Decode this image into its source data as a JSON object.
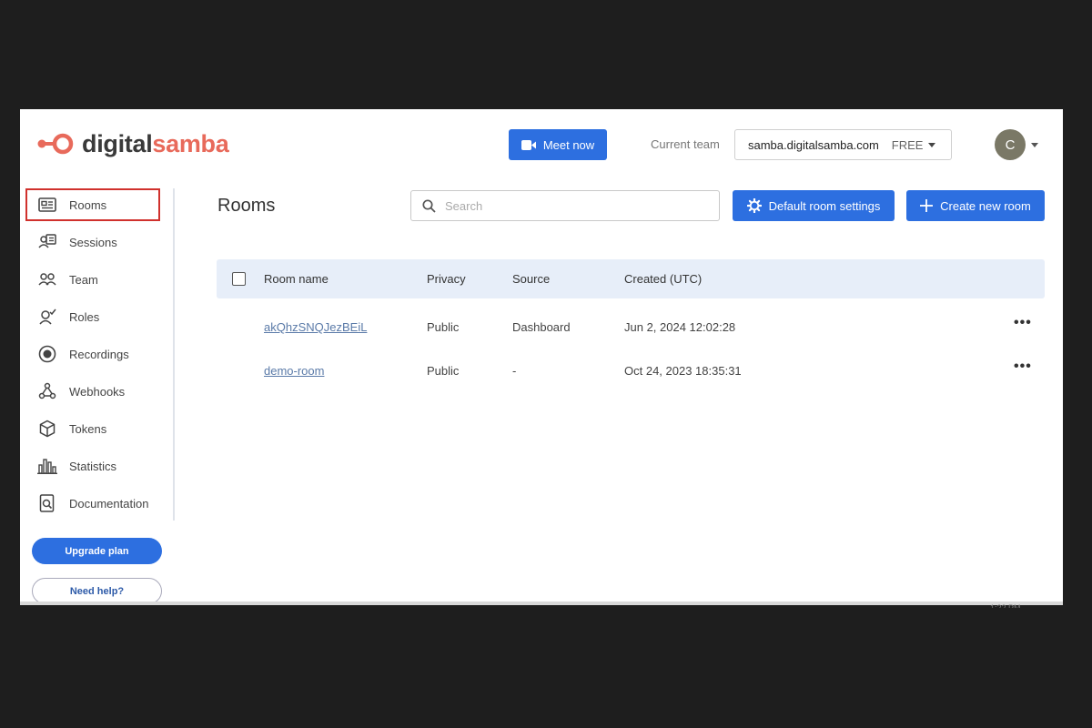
{
  "header": {
    "logo_dark": "digital",
    "logo_accent": "samba",
    "meet_now": "Meet now",
    "current_team_label": "Current team",
    "team_name": "samba.digitalsamba.com",
    "team_plan": "FREE",
    "avatar_initial": "C"
  },
  "sidebar": {
    "items": [
      {
        "label": "Rooms",
        "icon": "rooms-icon"
      },
      {
        "label": "Sessions",
        "icon": "sessions-icon"
      },
      {
        "label": "Team",
        "icon": "team-icon"
      },
      {
        "label": "Roles",
        "icon": "roles-icon"
      },
      {
        "label": "Recordings",
        "icon": "recordings-icon"
      },
      {
        "label": "Webhooks",
        "icon": "webhooks-icon"
      },
      {
        "label": "Tokens",
        "icon": "tokens-icon"
      },
      {
        "label": "Statistics",
        "icon": "statistics-icon"
      },
      {
        "label": "Documentation",
        "icon": "documentation-icon"
      }
    ],
    "upgrade": "Upgrade plan",
    "help": "Need help?"
  },
  "main": {
    "title": "Rooms",
    "search_placeholder": "Search",
    "default_settings": "Default room settings",
    "create_room": "Create new room",
    "columns": [
      "Room name",
      "Privacy",
      "Source",
      "Created (UTC)"
    ],
    "rows": [
      {
        "name": "akQhzSNQJezBEiL",
        "privacy": "Public",
        "source": "Dashboard",
        "created": "Jun 2, 2024 12:02:28"
      },
      {
        "name": "demo-room",
        "privacy": "Public",
        "source": "-",
        "created": "Oct 24, 2023 18:35:31"
      }
    ]
  },
  "colors": {
    "brand_blue": "#2d6fe0",
    "brand_coral": "#e86a5b",
    "highlight_red": "#d0312d"
  },
  "stray_time": "1:22 PM"
}
